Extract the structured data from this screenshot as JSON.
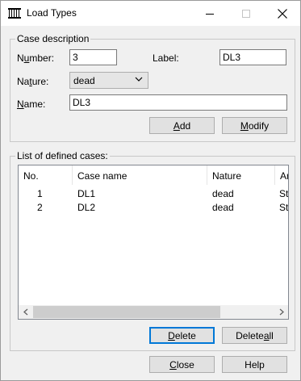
{
  "window": {
    "title": "Load Types"
  },
  "case_description": {
    "group_label": "Case description",
    "number_label": {
      "pre": "N",
      "u": "u",
      "post": "mber:"
    },
    "number_value": "3",
    "label_label": "Label:",
    "label_value": "DL3",
    "nature_label": {
      "pre": "Na",
      "u": "t",
      "post": "ure:"
    },
    "nature_value": "dead",
    "name_label": {
      "pre": "",
      "u": "N",
      "post": "ame:"
    },
    "name_value": "DL3",
    "add_button": {
      "pre": "",
      "u": "A",
      "post": "dd"
    },
    "modify_button": {
      "pre": "",
      "u": "M",
      "post": "odify"
    }
  },
  "defined_cases": {
    "group_label": "List of defined cases:",
    "columns": [
      "No.",
      "Case name",
      "Nature",
      "An"
    ],
    "rows": [
      {
        "no": "1",
        "name": "DL1",
        "nature": "dead",
        "extra": "St"
      },
      {
        "no": "2",
        "name": "DL2",
        "nature": "dead",
        "extra": "St"
      }
    ],
    "delete_button": {
      "pre": "",
      "u": "D",
      "post": "elete"
    },
    "delete_all_button": {
      "pre": "Delete ",
      "u": "a",
      "post": "ll"
    }
  },
  "footer": {
    "close_button": {
      "pre": "",
      "u": "C",
      "post": "lose"
    },
    "help_button": "Help"
  }
}
